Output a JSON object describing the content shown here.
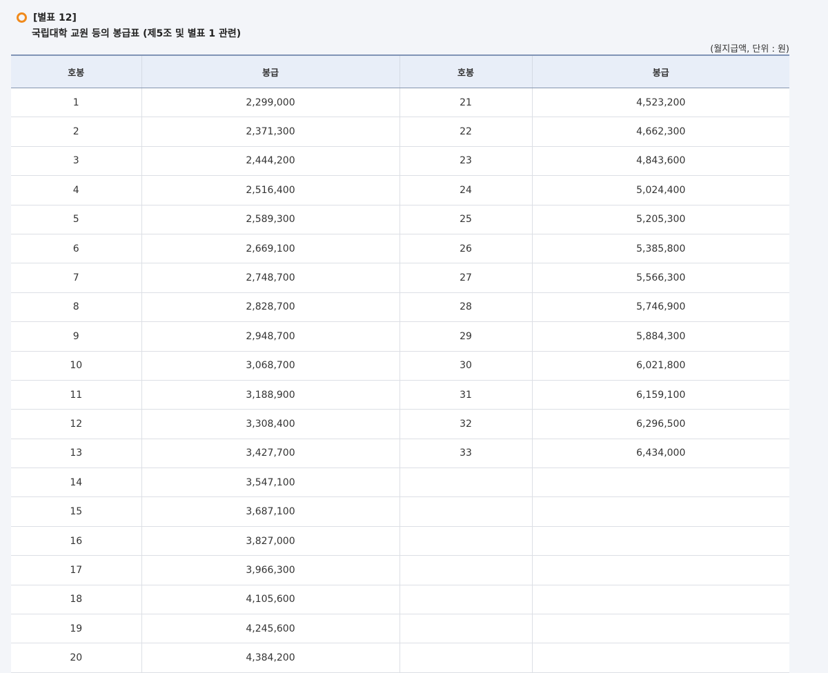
{
  "header": {
    "annex_label": "[별표 12]",
    "title": "국립대학 교원 등의 봉급표 (제5조 및 별표 1 관련)",
    "unit_note": "(월지급액, 단위 : 원)"
  },
  "table": {
    "headers": [
      "호봉",
      "봉급",
      "호봉",
      "봉급"
    ],
    "rows": [
      [
        "1",
        "2,299,000",
        "21",
        "4,523,200"
      ],
      [
        "2",
        "2,371,300",
        "22",
        "4,662,300"
      ],
      [
        "3",
        "2,444,200",
        "23",
        "4,843,600"
      ],
      [
        "4",
        "2,516,400",
        "24",
        "5,024,400"
      ],
      [
        "5",
        "2,589,300",
        "25",
        "5,205,300"
      ],
      [
        "6",
        "2,669,100",
        "26",
        "5,385,800"
      ],
      [
        "7",
        "2,748,700",
        "27",
        "5,566,300"
      ],
      [
        "8",
        "2,828,700",
        "28",
        "5,746,900"
      ],
      [
        "9",
        "2,948,700",
        "29",
        "5,884,300"
      ],
      [
        "10",
        "3,068,700",
        "30",
        "6,021,800"
      ],
      [
        "11",
        "3,188,900",
        "31",
        "6,159,100"
      ],
      [
        "12",
        "3,308,400",
        "32",
        "6,296,500"
      ],
      [
        "13",
        "3,427,700",
        "33",
        "6,434,000"
      ],
      [
        "14",
        "3,547,100",
        "",
        ""
      ],
      [
        "15",
        "3,687,100",
        "",
        ""
      ],
      [
        "16",
        "3,827,000",
        "",
        ""
      ],
      [
        "17",
        "3,966,300",
        "",
        ""
      ],
      [
        "18",
        "4,105,600",
        "",
        ""
      ],
      [
        "19",
        "4,245,600",
        "",
        ""
      ],
      [
        "20",
        "4,384,200",
        "",
        ""
      ]
    ]
  },
  "colors": {
    "accent": "#f08a1c",
    "header_bg": "#e8eef8"
  }
}
